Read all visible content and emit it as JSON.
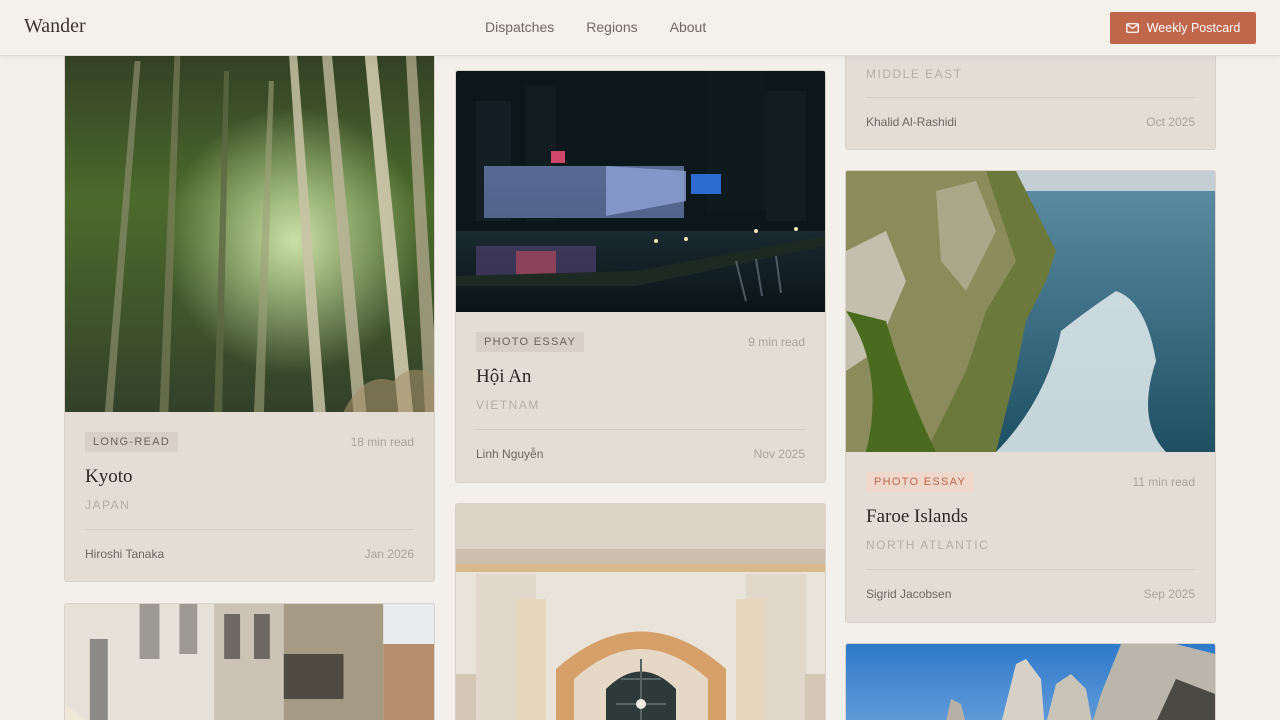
{
  "header": {
    "brand": "Wander",
    "nav": [
      "Dispatches",
      "Regions",
      "About"
    ],
    "cta_label": "Weekly Postcard",
    "cta_icon": "mail-icon",
    "accent_color": "#c0664a"
  },
  "cards": {
    "kyoto": {
      "tag": "LONG-READ",
      "read": "18 min read",
      "title": "Kyoto",
      "region": "JAPAN",
      "author": "Hiroshi Tanaka",
      "date": "Jan 2026"
    },
    "hoian": {
      "tag": "PHOTO ESSAY",
      "read": "9 min read",
      "title": "Hội An",
      "region": "VIETNAM",
      "author": "Linh Nguyễn",
      "date": "Nov 2025"
    },
    "middleeast": {
      "region": "MIDDLE EAST",
      "author": "Khalid Al-Rashidi",
      "date": "Oct 2025"
    },
    "faroe": {
      "tag": "PHOTO ESSAY",
      "read": "11 min read",
      "title": "Faroe Islands",
      "region": "NORTH ATLANTIC",
      "author": "Sigrid Jacobsen",
      "date": "Sep 2025"
    }
  }
}
